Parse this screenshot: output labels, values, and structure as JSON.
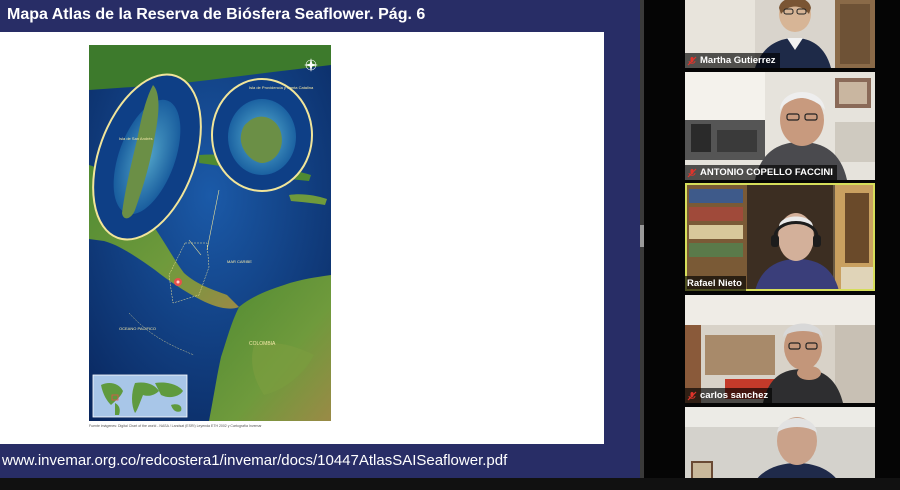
{
  "slide": {
    "title": "Mapa Atlas de la Reserva de Biósfera Seaflower. Pág. 6",
    "map_labels": {
      "san_andres": "Isla de San Andrés",
      "providencia": "Isla de Providencia y Santa Catalina",
      "mar_caribe": "MAR CARIBE",
      "oceano_pacifico": "OCEANO PACIFICO",
      "colombia": "COLOMBIA"
    },
    "map_credit": "Fuente imágenes: Digital Chart of the world - NASA / Landsat (ESRI) Leyenda ETH 2002 y Cartografía Invemar",
    "source_url": "www.invemar.org.co/redcostera1/invemar/docs/10447AtlasSAISeaflower.pdf"
  },
  "participants": [
    {
      "name": "Martha Gutierrez",
      "muted": true
    },
    {
      "name": "ANTONIO COPELLO FACCINI",
      "muted": true
    },
    {
      "name": "Rafael Nieto",
      "muted": false,
      "active_speaker": true
    },
    {
      "name": "carlos sanchez",
      "muted": true
    },
    {
      "name": "",
      "muted": true
    }
  ],
  "colors": {
    "slide_background": "#282d66",
    "active_speaker_border": "#d6de5a",
    "muted_icon": "#e0342b"
  },
  "icons": [
    "muted-mic-icon",
    "compass-rose-icon"
  ]
}
